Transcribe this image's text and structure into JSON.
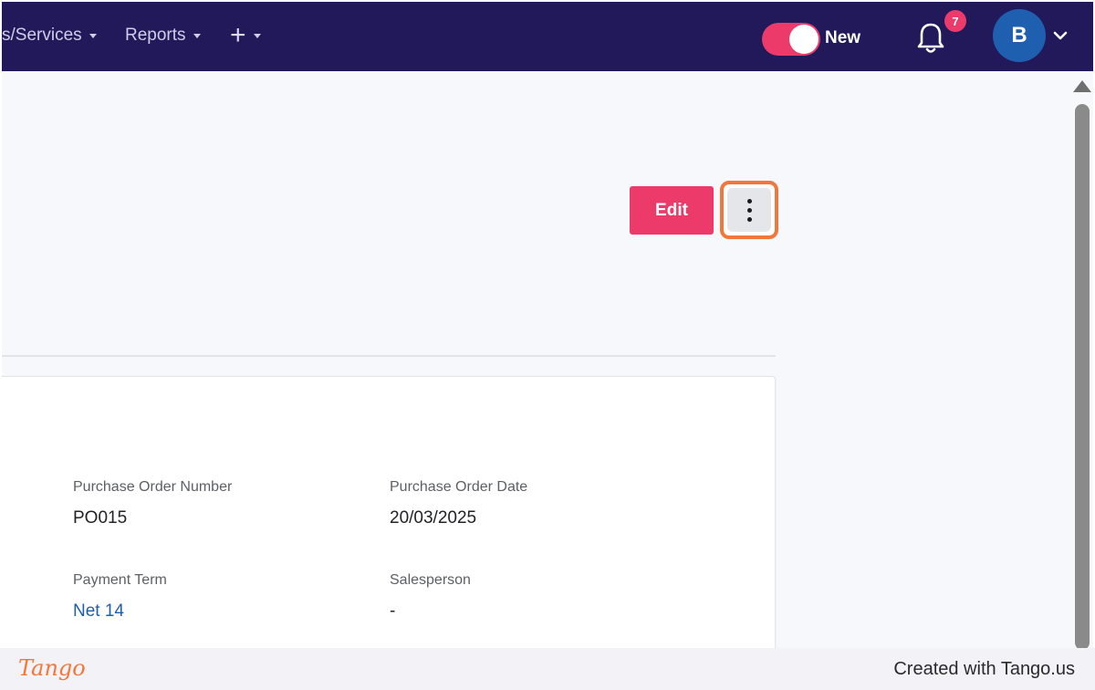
{
  "nav": {
    "items": [
      {
        "label": "s/Services"
      },
      {
        "label": "Reports"
      }
    ],
    "toggle_label": "New",
    "notification_count": "7",
    "avatar_initial": "B"
  },
  "actions": {
    "edit_label": "Edit"
  },
  "details": {
    "po_number_label": "Purchase Order Number",
    "po_number_value": "PO015",
    "po_date_label": "Purchase Order Date",
    "po_date_value": "20/03/2025",
    "payment_term_label": "Payment Term",
    "payment_term_value": "Net 14",
    "salesperson_label": "Salesperson",
    "salesperson_value": "-"
  },
  "footer": {
    "logo_text": "Tango",
    "created_with": "Created with Tango.us"
  },
  "colors": {
    "nav_bg": "#21195a",
    "accent": "#ec3b6b",
    "highlight": "#f2773a",
    "link": "#1f5fa8",
    "avatar_bg": "#1f5fb0"
  }
}
